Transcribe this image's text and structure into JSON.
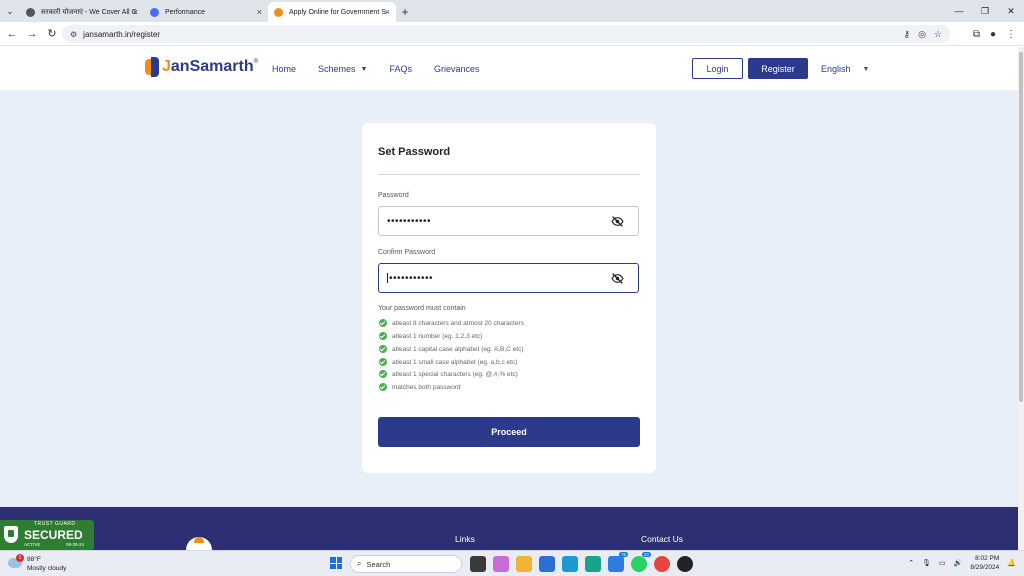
{
  "browser": {
    "tabs": [
      {
        "title": "सरकारी योजनाएं - We Cover All G",
        "favicon_color": "#555555",
        "active": false
      },
      {
        "title": "Performance",
        "favicon_color": "#4a6cf7",
        "active": false
      },
      {
        "title": "Apply Online for Government S",
        "favicon_color": "#f28c1b",
        "active": true
      }
    ],
    "url": "jansamarth.in/register",
    "new_tab_label": "+"
  },
  "header": {
    "logo_text_prefix": "J",
    "logo_text_rest": "anSamarth",
    "logo_tm": "®",
    "nav": [
      "Home",
      "Schemes",
      "FAQs",
      "Grievances"
    ],
    "login_label": "Login",
    "register_label": "Register",
    "language": "English"
  },
  "form": {
    "title": "Set Password",
    "password_label": "Password",
    "password_value": "•••••••••••",
    "confirm_label": "Confirm Password",
    "confirm_value": "•••••••••••",
    "rules_heading": "Your password must contain",
    "rules": [
      "atleast 8 characters and atmost 20 characters",
      "atleast 1 number (eg. 1,2,3 etc)",
      "atleast 1 capital case alphabet (eg. A,B,C etc)",
      "atleast 1 small case alphabet (eg. a,b,c etc)",
      "atleast 1 special characters (eg. @,#,% etc)",
      "matches both password"
    ],
    "proceed_label": "Proceed"
  },
  "footer": {
    "links_heading": "Links",
    "contact_heading": "Contact Us"
  },
  "trust_badge": {
    "top": "TRUST GUARD",
    "main": "SECURED",
    "status": "ACTIVE",
    "date": "08-29-24"
  },
  "taskbar": {
    "weather_temp": "88°F",
    "weather_cond": "Mostly cloudy",
    "weather_badge": "1",
    "search_placeholder": "Search",
    "time": "8:02 PM",
    "date": "8/29/2024",
    "badge_counts": [
      "76",
      "22"
    ]
  },
  "colors": {
    "brand_blue": "#2c3a8c",
    "brand_orange": "#f28c1b",
    "success_green": "#4caf50",
    "page_bg": "#e9eff9"
  }
}
